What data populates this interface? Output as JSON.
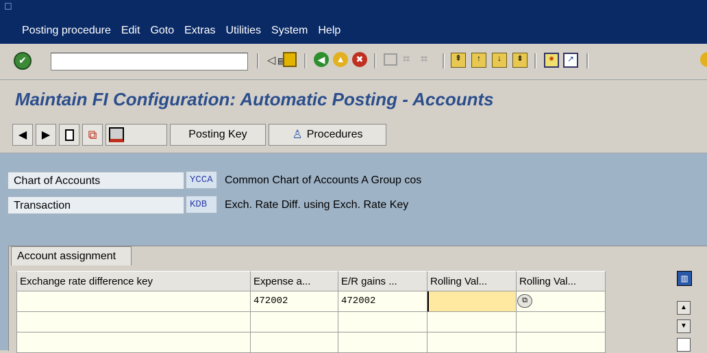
{
  "menubar": {
    "items": [
      "Posting procedure",
      "Edit",
      "Goto",
      "Extras",
      "Utilities",
      "System",
      "Help"
    ]
  },
  "toolbar": {
    "command_value": ""
  },
  "page": {
    "title": "Maintain FI Configuration: Automatic Posting - Accounts"
  },
  "app_toolbar": {
    "posting_key_label": "Posting Key",
    "procedures_label": "Procedures"
  },
  "header_fields": {
    "chart_label": "Chart of Accounts",
    "chart_value": "YCCA",
    "chart_desc": "Common Chart of Accounts A Group cos",
    "transaction_label": "Transaction",
    "transaction_value": "KDB",
    "transaction_desc": "Exch. Rate Diff. using Exch. Rate Key"
  },
  "tab": {
    "label": "Account assignment"
  },
  "table": {
    "headers": [
      "Exchange rate difference key",
      "Expense a...",
      "E/R gains ...",
      "Rolling Val...",
      "Rolling Val..."
    ],
    "rows": [
      [
        "",
        "472002",
        "472002",
        "",
        ""
      ],
      [
        "",
        "",
        "",
        "",
        ""
      ],
      [
        "",
        "",
        "",
        "",
        ""
      ]
    ]
  },
  "colors": {
    "menubar": "#0a2a66",
    "title": "#2b4e8c",
    "content": "#9fb3c6",
    "active_field": "#ffe9a0"
  }
}
